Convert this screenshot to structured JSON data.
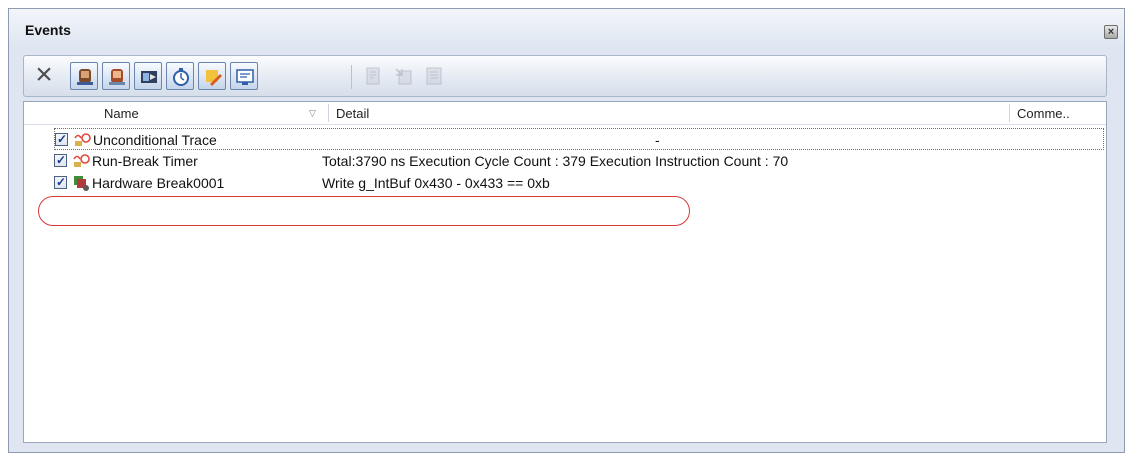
{
  "window": {
    "title": "Events",
    "close_icon": "close-icon"
  },
  "toolbar": {
    "delete_icon": "delete-icon",
    "buttons": [
      "hardware-break-filter-icon",
      "software-break-filter-icon",
      "trace-filter-icon",
      "timer-filter-icon",
      "condition-filter-icon",
      "display-filter-icon"
    ],
    "disabled_buttons": [
      "edit-condition-icon",
      "jump-source-icon",
      "jump-disassemble-icon"
    ]
  },
  "columns": {
    "name": "Name",
    "detail": "Detail",
    "comment": "Comme.."
  },
  "rows": [
    {
      "checked": true,
      "icon": "trace-event-icon",
      "name": "Unconditional Trace",
      "detail": "-"
    },
    {
      "checked": true,
      "icon": "timer-event-icon",
      "name": "Run-Break Timer",
      "detail": "Total:3790 ns Execution Cycle Count : 379 Execution Instruction Count : 70"
    },
    {
      "checked": true,
      "icon": "hardware-break-icon",
      "name": "Hardware Break0001",
      "detail": "Write g_IntBuf 0x430 - 0x433 == 0xb"
    }
  ],
  "colors": {
    "highlight": "#d83a3a",
    "toolbar_border": "#6b86ad"
  }
}
